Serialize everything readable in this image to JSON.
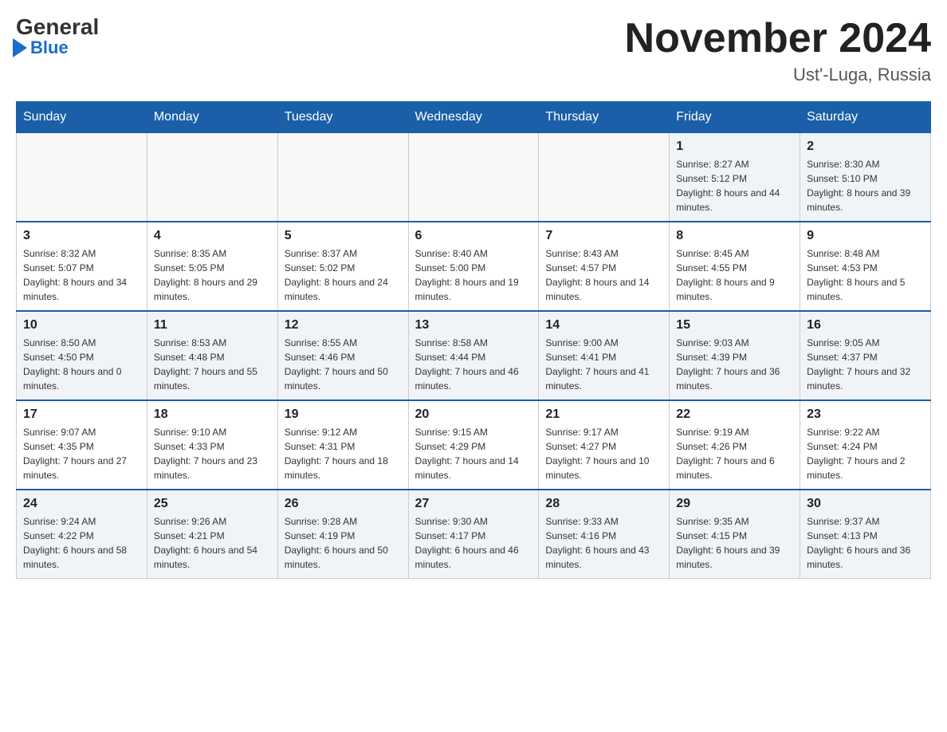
{
  "header": {
    "logo_general": "General",
    "logo_blue": "Blue",
    "month_title": "November 2024",
    "location": "Ust'-Luga, Russia"
  },
  "days_of_week": [
    "Sunday",
    "Monday",
    "Tuesday",
    "Wednesday",
    "Thursday",
    "Friday",
    "Saturday"
  ],
  "weeks": [
    [
      {
        "day": "",
        "sunrise": "",
        "sunset": "",
        "daylight": ""
      },
      {
        "day": "",
        "sunrise": "",
        "sunset": "",
        "daylight": ""
      },
      {
        "day": "",
        "sunrise": "",
        "sunset": "",
        "daylight": ""
      },
      {
        "day": "",
        "sunrise": "",
        "sunset": "",
        "daylight": ""
      },
      {
        "day": "",
        "sunrise": "",
        "sunset": "",
        "daylight": ""
      },
      {
        "day": "1",
        "sunrise": "Sunrise: 8:27 AM",
        "sunset": "Sunset: 5:12 PM",
        "daylight": "Daylight: 8 hours and 44 minutes."
      },
      {
        "day": "2",
        "sunrise": "Sunrise: 8:30 AM",
        "sunset": "Sunset: 5:10 PM",
        "daylight": "Daylight: 8 hours and 39 minutes."
      }
    ],
    [
      {
        "day": "3",
        "sunrise": "Sunrise: 8:32 AM",
        "sunset": "Sunset: 5:07 PM",
        "daylight": "Daylight: 8 hours and 34 minutes."
      },
      {
        "day": "4",
        "sunrise": "Sunrise: 8:35 AM",
        "sunset": "Sunset: 5:05 PM",
        "daylight": "Daylight: 8 hours and 29 minutes."
      },
      {
        "day": "5",
        "sunrise": "Sunrise: 8:37 AM",
        "sunset": "Sunset: 5:02 PM",
        "daylight": "Daylight: 8 hours and 24 minutes."
      },
      {
        "day": "6",
        "sunrise": "Sunrise: 8:40 AM",
        "sunset": "Sunset: 5:00 PM",
        "daylight": "Daylight: 8 hours and 19 minutes."
      },
      {
        "day": "7",
        "sunrise": "Sunrise: 8:43 AM",
        "sunset": "Sunset: 4:57 PM",
        "daylight": "Daylight: 8 hours and 14 minutes."
      },
      {
        "day": "8",
        "sunrise": "Sunrise: 8:45 AM",
        "sunset": "Sunset: 4:55 PM",
        "daylight": "Daylight: 8 hours and 9 minutes."
      },
      {
        "day": "9",
        "sunrise": "Sunrise: 8:48 AM",
        "sunset": "Sunset: 4:53 PM",
        "daylight": "Daylight: 8 hours and 5 minutes."
      }
    ],
    [
      {
        "day": "10",
        "sunrise": "Sunrise: 8:50 AM",
        "sunset": "Sunset: 4:50 PM",
        "daylight": "Daylight: 8 hours and 0 minutes."
      },
      {
        "day": "11",
        "sunrise": "Sunrise: 8:53 AM",
        "sunset": "Sunset: 4:48 PM",
        "daylight": "Daylight: 7 hours and 55 minutes."
      },
      {
        "day": "12",
        "sunrise": "Sunrise: 8:55 AM",
        "sunset": "Sunset: 4:46 PM",
        "daylight": "Daylight: 7 hours and 50 minutes."
      },
      {
        "day": "13",
        "sunrise": "Sunrise: 8:58 AM",
        "sunset": "Sunset: 4:44 PM",
        "daylight": "Daylight: 7 hours and 46 minutes."
      },
      {
        "day": "14",
        "sunrise": "Sunrise: 9:00 AM",
        "sunset": "Sunset: 4:41 PM",
        "daylight": "Daylight: 7 hours and 41 minutes."
      },
      {
        "day": "15",
        "sunrise": "Sunrise: 9:03 AM",
        "sunset": "Sunset: 4:39 PM",
        "daylight": "Daylight: 7 hours and 36 minutes."
      },
      {
        "day": "16",
        "sunrise": "Sunrise: 9:05 AM",
        "sunset": "Sunset: 4:37 PM",
        "daylight": "Daylight: 7 hours and 32 minutes."
      }
    ],
    [
      {
        "day": "17",
        "sunrise": "Sunrise: 9:07 AM",
        "sunset": "Sunset: 4:35 PM",
        "daylight": "Daylight: 7 hours and 27 minutes."
      },
      {
        "day": "18",
        "sunrise": "Sunrise: 9:10 AM",
        "sunset": "Sunset: 4:33 PM",
        "daylight": "Daylight: 7 hours and 23 minutes."
      },
      {
        "day": "19",
        "sunrise": "Sunrise: 9:12 AM",
        "sunset": "Sunset: 4:31 PM",
        "daylight": "Daylight: 7 hours and 18 minutes."
      },
      {
        "day": "20",
        "sunrise": "Sunrise: 9:15 AM",
        "sunset": "Sunset: 4:29 PM",
        "daylight": "Daylight: 7 hours and 14 minutes."
      },
      {
        "day": "21",
        "sunrise": "Sunrise: 9:17 AM",
        "sunset": "Sunset: 4:27 PM",
        "daylight": "Daylight: 7 hours and 10 minutes."
      },
      {
        "day": "22",
        "sunrise": "Sunrise: 9:19 AM",
        "sunset": "Sunset: 4:26 PM",
        "daylight": "Daylight: 7 hours and 6 minutes."
      },
      {
        "day": "23",
        "sunrise": "Sunrise: 9:22 AM",
        "sunset": "Sunset: 4:24 PM",
        "daylight": "Daylight: 7 hours and 2 minutes."
      }
    ],
    [
      {
        "day": "24",
        "sunrise": "Sunrise: 9:24 AM",
        "sunset": "Sunset: 4:22 PM",
        "daylight": "Daylight: 6 hours and 58 minutes."
      },
      {
        "day": "25",
        "sunrise": "Sunrise: 9:26 AM",
        "sunset": "Sunset: 4:21 PM",
        "daylight": "Daylight: 6 hours and 54 minutes."
      },
      {
        "day": "26",
        "sunrise": "Sunrise: 9:28 AM",
        "sunset": "Sunset: 4:19 PM",
        "daylight": "Daylight: 6 hours and 50 minutes."
      },
      {
        "day": "27",
        "sunrise": "Sunrise: 9:30 AM",
        "sunset": "Sunset: 4:17 PM",
        "daylight": "Daylight: 6 hours and 46 minutes."
      },
      {
        "day": "28",
        "sunrise": "Sunrise: 9:33 AM",
        "sunset": "Sunset: 4:16 PM",
        "daylight": "Daylight: 6 hours and 43 minutes."
      },
      {
        "day": "29",
        "sunrise": "Sunrise: 9:35 AM",
        "sunset": "Sunset: 4:15 PM",
        "daylight": "Daylight: 6 hours and 39 minutes."
      },
      {
        "day": "30",
        "sunrise": "Sunrise: 9:37 AM",
        "sunset": "Sunset: 4:13 PM",
        "daylight": "Daylight: 6 hours and 36 minutes."
      }
    ]
  ]
}
